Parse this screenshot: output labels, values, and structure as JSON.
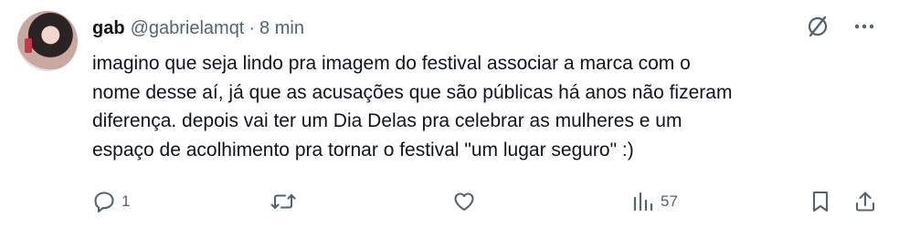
{
  "author": {
    "name": "gab",
    "handle": "@gabrielamqt",
    "separator": "·",
    "time": "8 min"
  },
  "tweet": {
    "lines": [
      "imagino que seja lindo pra imagem do festival associar a marca com o",
      "nome desse aí, já que as acusações que são públicas há anos não fizeram",
      "diferença. depois vai ter um Dia Delas pra celebrar as mulheres e um",
      "espaço de acolhimento pra tornar o festival \"um lugar seguro\" :)"
    ]
  },
  "actions": {
    "reply_count": "1",
    "retweet_count": "",
    "like_count": "",
    "views_count": "57"
  },
  "icons": {
    "grok": "slashed-circle-icon",
    "more": "more-icon",
    "reply": "reply-icon",
    "retweet": "retweet-icon",
    "like": "heart-icon",
    "views": "views-icon",
    "bookmark": "bookmark-icon",
    "share": "share-icon"
  },
  "colors": {
    "text": "#0f1419",
    "secondary": "#536471",
    "background": "#ffffff"
  }
}
